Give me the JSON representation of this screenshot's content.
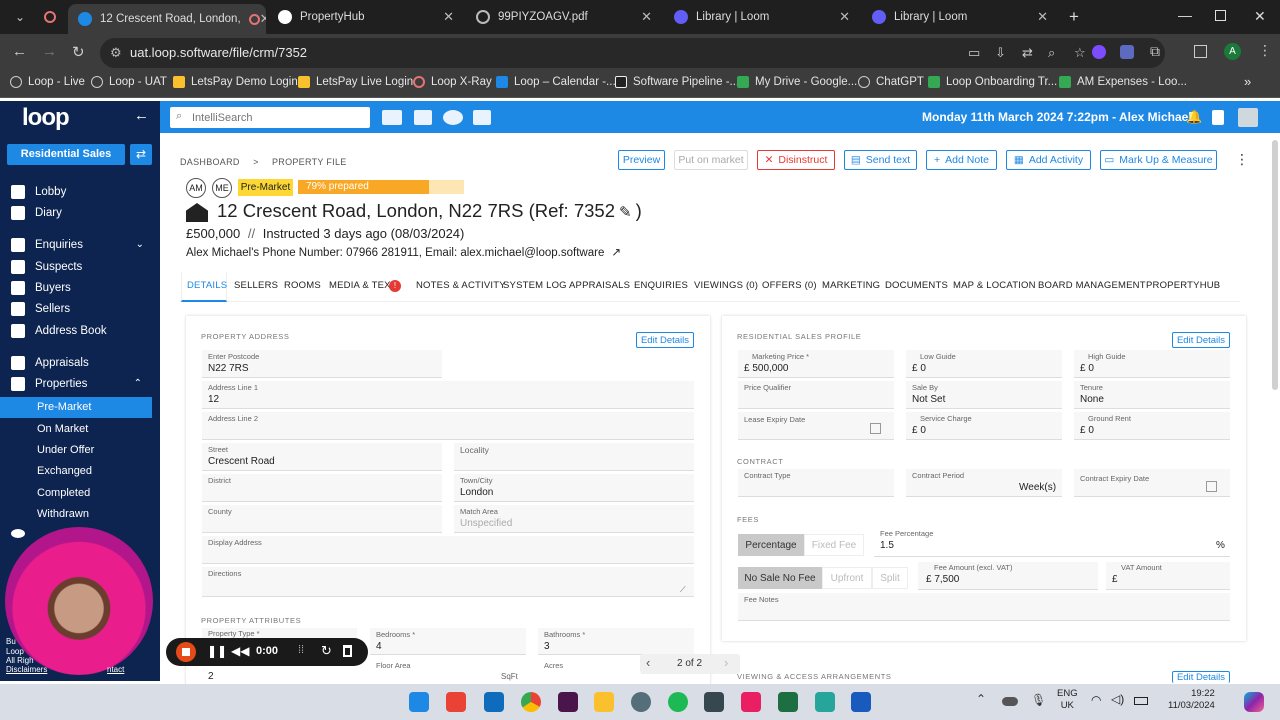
{
  "browser": {
    "tabs": [
      {
        "label": "12 Crescent Road, London,",
        "active": true
      },
      {
        "label": "PropertyHub"
      },
      {
        "label": "99PIYZOAGV.pdf"
      },
      {
        "label": "Library | Loom"
      },
      {
        "label": "Library | Loom"
      }
    ],
    "url": "uat.loop.software/file/crm/7352",
    "bookmarks": [
      "Loop - Live",
      "Loop - UAT",
      "LetsPay Demo Login",
      "LetsPay Live Login",
      "Loop X-Ray",
      "Loop – Calendar -...",
      "Software Pipeline -...",
      "My Drive - Google...",
      "ChatGPT",
      "Loop Onboarding Tr...",
      "AM Expenses - Loo..."
    ],
    "profile_initial": "A"
  },
  "app": {
    "logo": "loop",
    "search_placeholder": "IntelliSearch",
    "header_datetime": "Monday 11th March 2024 7:22pm - Alex Michael",
    "department": "Residential Sales"
  },
  "sidebar": {
    "items": [
      "Lobby",
      "Diary",
      "Enquiries",
      "Suspects",
      "Buyers",
      "Sellers",
      "Address Book",
      "Appraisals",
      "Properties"
    ],
    "sub_items": [
      "Pre-Market",
      "On Market",
      "Under Offer",
      "Exchanged",
      "Completed",
      "Withdrawn"
    ],
    "footer": [
      "Bu",
      "Loop",
      "All Righ",
      "Disclaimers"
    ],
    "footer_link": "ntact"
  },
  "breadcrumb": {
    "first": "DASHBOARD",
    "second": "PROPERTY FILE"
  },
  "actions": [
    "Preview",
    "Put on market",
    "Disinstruct",
    "Send text",
    "Add Note",
    "Add Activity",
    "Mark Up & Measure"
  ],
  "property": {
    "avatars": [
      "AM",
      "ME"
    ],
    "status": "Pre-Market",
    "progress_label": "79% prepared",
    "progress": 0.79,
    "title": "12 Crescent Road, London, N22 7RS (Ref: 7352",
    "title_close": ")",
    "price": "£500,000",
    "sep": "//",
    "instructed": "Instructed 3 days ago (08/03/2024)",
    "contact_prefix": "Alex Michael's Phone Number:",
    "phone": "07966 281911",
    "email_prefix": ", Email:",
    "email": "alex.michael@loop.software"
  },
  "tabs": [
    "DETAILS",
    "SELLERS",
    "ROOMS",
    "MEDIA & TEXT",
    "NOTES & ACTIVITY",
    "SYSTEM LOG",
    "APPRAISALS",
    "ENQUIRIES",
    "VIEWINGS (0)",
    "OFFERS (0)",
    "MARKETING",
    "DOCUMENTS",
    "MAP & LOCATION",
    "BOARD MANAGEMENT",
    "PROPERTYHUB"
  ],
  "address": {
    "section": "PROPERTY ADDRESS",
    "edit": "Edit Details",
    "postcode_label": "Enter Postcode",
    "postcode": "N22 7RS",
    "line1_label": "Address Line 1",
    "line1": "12",
    "line2_label": "Address Line 2",
    "street_label": "Street",
    "street": "Crescent Road",
    "locality_label": "Locality",
    "district_label": "District",
    "town_label": "Town/City",
    "town": "London",
    "county_label": "County",
    "match_label": "Match Area",
    "match": "Unspecified",
    "display_label": "Display Address",
    "directions_label": "Directions"
  },
  "attributes": {
    "section": "PROPERTY ATTRIBUTES",
    "type_label": "Property Type *",
    "bedrooms_label": "Bedrooms *",
    "bedrooms": "4",
    "bathrooms_label": "Bathrooms *",
    "bathrooms": "3",
    "floor_label": "Floor Area",
    "floor_unit": "SqFt",
    "acres_label": "Acres",
    "first_value": "2"
  },
  "sales": {
    "section": "RESIDENTIAL SALES PROFILE",
    "edit": "Edit Details",
    "mprice_label": "Marketing Price *",
    "mprice": "£ 500,000",
    "low_label": "Low Guide",
    "low": "£ 0",
    "high_label": "High Guide",
    "high": "£ 0",
    "qualifier_label": "Price Qualifier",
    "saleby_label": "Sale By",
    "saleby": "Not Set",
    "tenure_label": "Tenure",
    "tenure": "None",
    "lease_label": "Lease Expiry Date",
    "service_label": "Service Charge",
    "service": "£ 0",
    "ground_label": "Ground Rent",
    "ground": "£ 0",
    "contract_section": "CONTRACT",
    "ctype_label": "Contract Type",
    "cperiod_label": "Contract Period",
    "cperiod_unit": "Week(s)",
    "cexpiry_label": "Contract Expiry Date",
    "fees_section": "FEES",
    "fee_mode_on": "Percentage",
    "fee_mode_off": "Fixed Fee",
    "fee_pct_label": "Fee Percentage",
    "fee_pct": "1.5",
    "fee_pct_unit": "%",
    "nsnf": "No Sale No Fee",
    "upfront": "Upfront",
    "split": "Split",
    "fee_amt_label": "Fee Amount (excl. VAT)",
    "fee_amt": "£ 7,500",
    "vat_label": "VAT Amount",
    "vat": "£",
    "notes_label": "Fee Notes",
    "viewing_section": "VIEWING & ACCESS ARRANGEMENTS",
    "edit2": "Edit Details"
  },
  "pager": {
    "label": "2 of 2"
  },
  "recorder": {
    "time": "0:00"
  },
  "taskbar": {
    "lang1": "ENG",
    "lang2": "UK",
    "time": "19:22",
    "date": "11/03/2024"
  }
}
